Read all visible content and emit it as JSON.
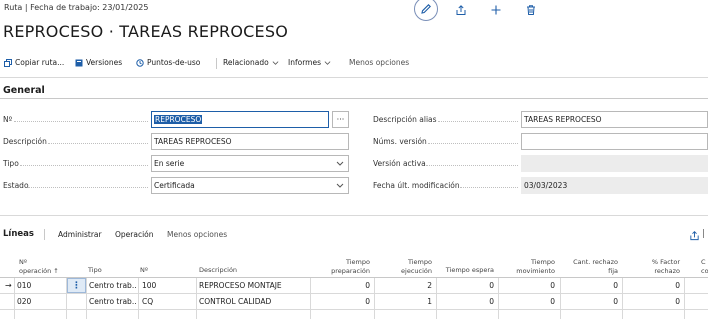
{
  "breadcrumb": "Ruta | Fecha de trabajo: 23/01/2025",
  "title": "REPROCESO · TAREAS REPROCESO",
  "actions": {
    "copy": "Copiar ruta...",
    "versions": "Versiones",
    "points": "Puntos-de-uso",
    "related": "Relacionado",
    "reports": "Informes",
    "fewer": "Menos opciones"
  },
  "section_title": "General",
  "fields": {
    "no_label": "Nº",
    "no_value": "REPROCESO",
    "desc_label": "Descripción",
    "desc_value": "TAREAS REPROCESO",
    "type_label": "Tipo",
    "type_value": "En serie",
    "state_label": "Estado",
    "state_value": "Certificada",
    "alias_label": "Descripción alias",
    "alias_value": "TAREAS REPROCESO",
    "versions_label": "Núms. versión",
    "versions_value": "",
    "active_label": "Versión activa",
    "active_value": "",
    "modified_label": "Fecha últ. modificación",
    "modified_value": "03/03/2023",
    "ellipsis": "···"
  },
  "lines": {
    "title": "Líneas",
    "admin": "Administrar",
    "operation": "Operación",
    "fewer": "Menos opciones",
    "columns": {
      "op_no_1": "Nº",
      "op_no_2": "operación ↑",
      "type": "Tipo",
      "no": "Nº",
      "desc": "Descripción",
      "setup_1": "Tiempo",
      "setup_2": "preparación",
      "run_1": "Tiempo",
      "run_2": "ejecución",
      "wait": "Tiempo espera",
      "move_1": "Tiempo",
      "move_2": "movimiento",
      "scrap_1": "Cant. rechazo",
      "scrap_2": "fija",
      "factor_1": "% Factor",
      "factor_2": "rechazo",
      "extra_1": "C",
      "extra_2": "co"
    },
    "rows": [
      {
        "arrow": "→",
        "menu": "⋮",
        "op": "010",
        "type": "Centro trab...",
        "no": "100",
        "desc": "REPROCESO MONTAJE",
        "setup": "0",
        "run": "2",
        "wait": "0",
        "move": "0",
        "scrap": "0",
        "factor": "0"
      },
      {
        "arrow": "",
        "menu": "",
        "op": "020",
        "type": "Centro trab...",
        "no": "CQ",
        "desc": "CONTROL CALIDAD",
        "setup": "0",
        "run": "1",
        "wait": "0",
        "move": "0",
        "scrap": "0",
        "factor": "0"
      }
    ]
  }
}
